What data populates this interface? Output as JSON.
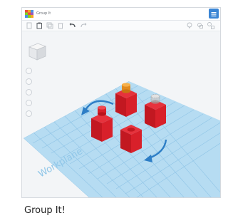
{
  "window": {
    "title": "Group It"
  },
  "workplane": {
    "label": "Workplane"
  },
  "caption": "Group It!",
  "icons": {
    "logo": "tinkercad-logo-icon",
    "toolbar_left": [
      "copy-icon",
      "paste-icon",
      "duplicate-icon",
      "delete-icon",
      "undo-icon",
      "redo-icon"
    ],
    "toolbar_right": [
      "light-bulb-icon",
      "group-icon",
      "ungroup-icon"
    ],
    "nav": [
      "home-view-icon",
      "fit-view-icon",
      "zoom-in-icon",
      "zoom-out-icon",
      "perspective-icon"
    ]
  },
  "colors": {
    "shape_red": "#d8202a",
    "workplane_blue": "#a9d5ef",
    "arrow_blue": "#2d7ec6",
    "accent_blue": "#3a85d4"
  }
}
